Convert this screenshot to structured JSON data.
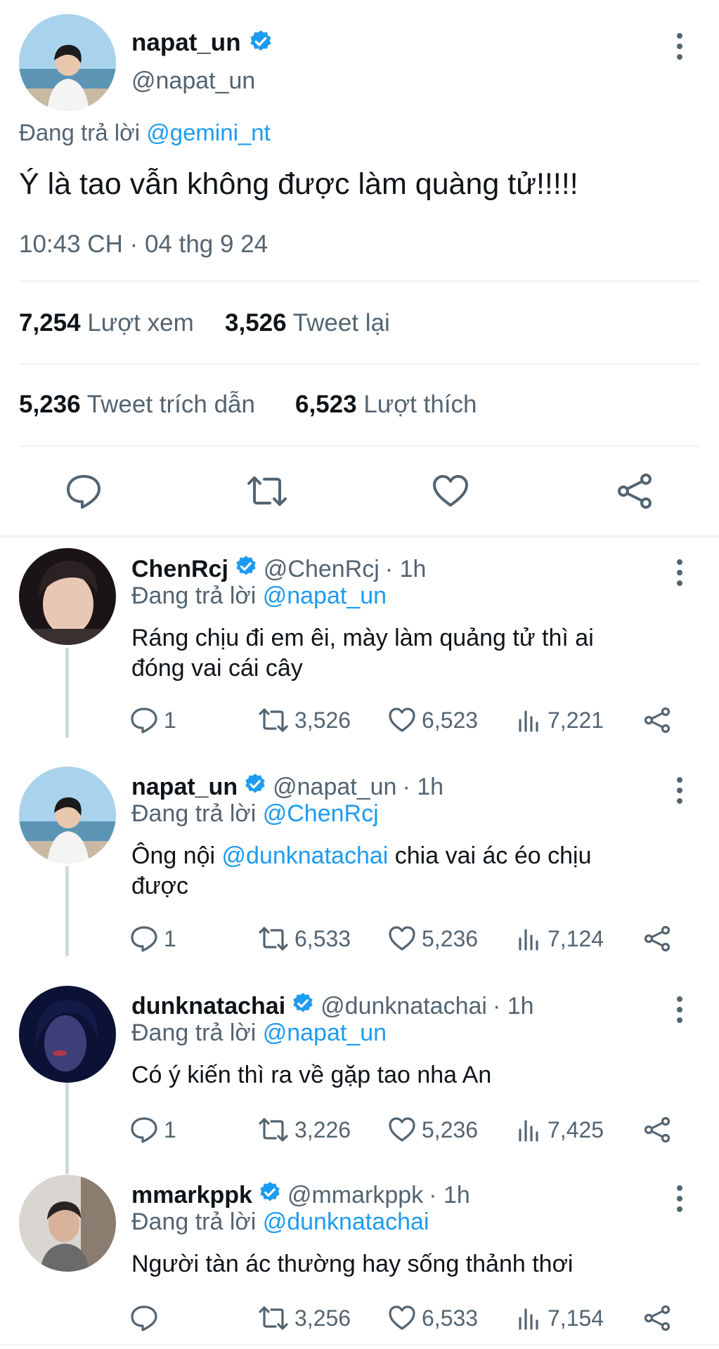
{
  "main_tweet": {
    "name": "napat_un",
    "handle": "@napat_un",
    "replying_prefix": "Đang trả lời",
    "replying_to": "@gemini_nt",
    "text": "Ý là tao vẫn không được làm quàng tử!!!!!",
    "timestamp": "10:43 CH · 04 thg 9 24",
    "stats": {
      "views_count": "7,254",
      "views_label": "Lượt xem",
      "retweets_count": "3,526",
      "retweets_label": "Tweet lại",
      "quotes_count": "5,236",
      "quotes_label": "Tweet trích dẫn",
      "likes_count": "6,523",
      "likes_label": "Lượt thích"
    },
    "actions": [
      "reply-icon",
      "retweet-icon",
      "like-icon",
      "share-icon"
    ]
  },
  "replies": [
    {
      "name": "ChenRcj",
      "handle": "@ChenRcj",
      "time": "· 1h",
      "replying_prefix": "Đang trả lời",
      "replying_to": "@napat_un",
      "text_line1": "Ráng chịu đi em êi, mày làm quảng tử thì ai",
      "text_line2": "đóng vai cái cây",
      "text_pre": "",
      "mention": "",
      "text_post": "",
      "replies": "1",
      "retweets": "3,526",
      "likes": "6,523",
      "views": "7,221"
    },
    {
      "name": "napat_un",
      "handle": "@napat_un",
      "time": "· 1h",
      "replying_prefix": "Đang trả lời",
      "replying_to": "@ChenRcj",
      "text_pre": "Ông nội ",
      "mention": "@dunknatachai",
      "text_post": " chia vai ác éo chịu",
      "text_line2": "được",
      "replies": "1",
      "retweets": "6,533",
      "likes": "5,236",
      "views": "7,124"
    },
    {
      "name": "dunknatachai",
      "handle": "@dunknatachai",
      "time": "· 1h",
      "replying_prefix": "Đang trả lời",
      "replying_to": "@napat_un",
      "text_line1": "Có ý kiến thì ra về gặp tao nha An",
      "replies": "1",
      "retweets": "3,226",
      "likes": "5,236",
      "views": "7,425"
    },
    {
      "name": "mmarkppk",
      "handle": "@mmarkppk",
      "time": "· 1h",
      "replying_prefix": "Đang trả lời",
      "replying_to": "@dunknatachai",
      "text_line1": "Người tàn ác thường hay sống thảnh thơi",
      "replies": "",
      "retweets": "3,256",
      "likes": "6,533",
      "views": "7,154"
    }
  ],
  "colors": {
    "link": "#1d9bf0",
    "verified": "#1d9bf0",
    "secondary_text": "#536471",
    "thread_line": "#cfd9de"
  }
}
